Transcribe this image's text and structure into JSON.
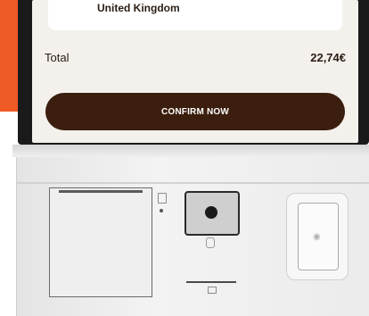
{
  "order": {
    "country": "United Kingdom",
    "total_label": "Total",
    "total_value": "22,74€"
  },
  "actions": {
    "confirm_label": "CONFIRM NOW"
  },
  "colors": {
    "brand_accent": "#f05a26",
    "button_bg": "#3b1e0d",
    "screen_bg": "#f4f1ed"
  },
  "icons": {
    "nfc": "contactless-icon",
    "printer": "receipt-icon",
    "scanner": "barcode-scanner-icon",
    "card": "card-icon"
  }
}
